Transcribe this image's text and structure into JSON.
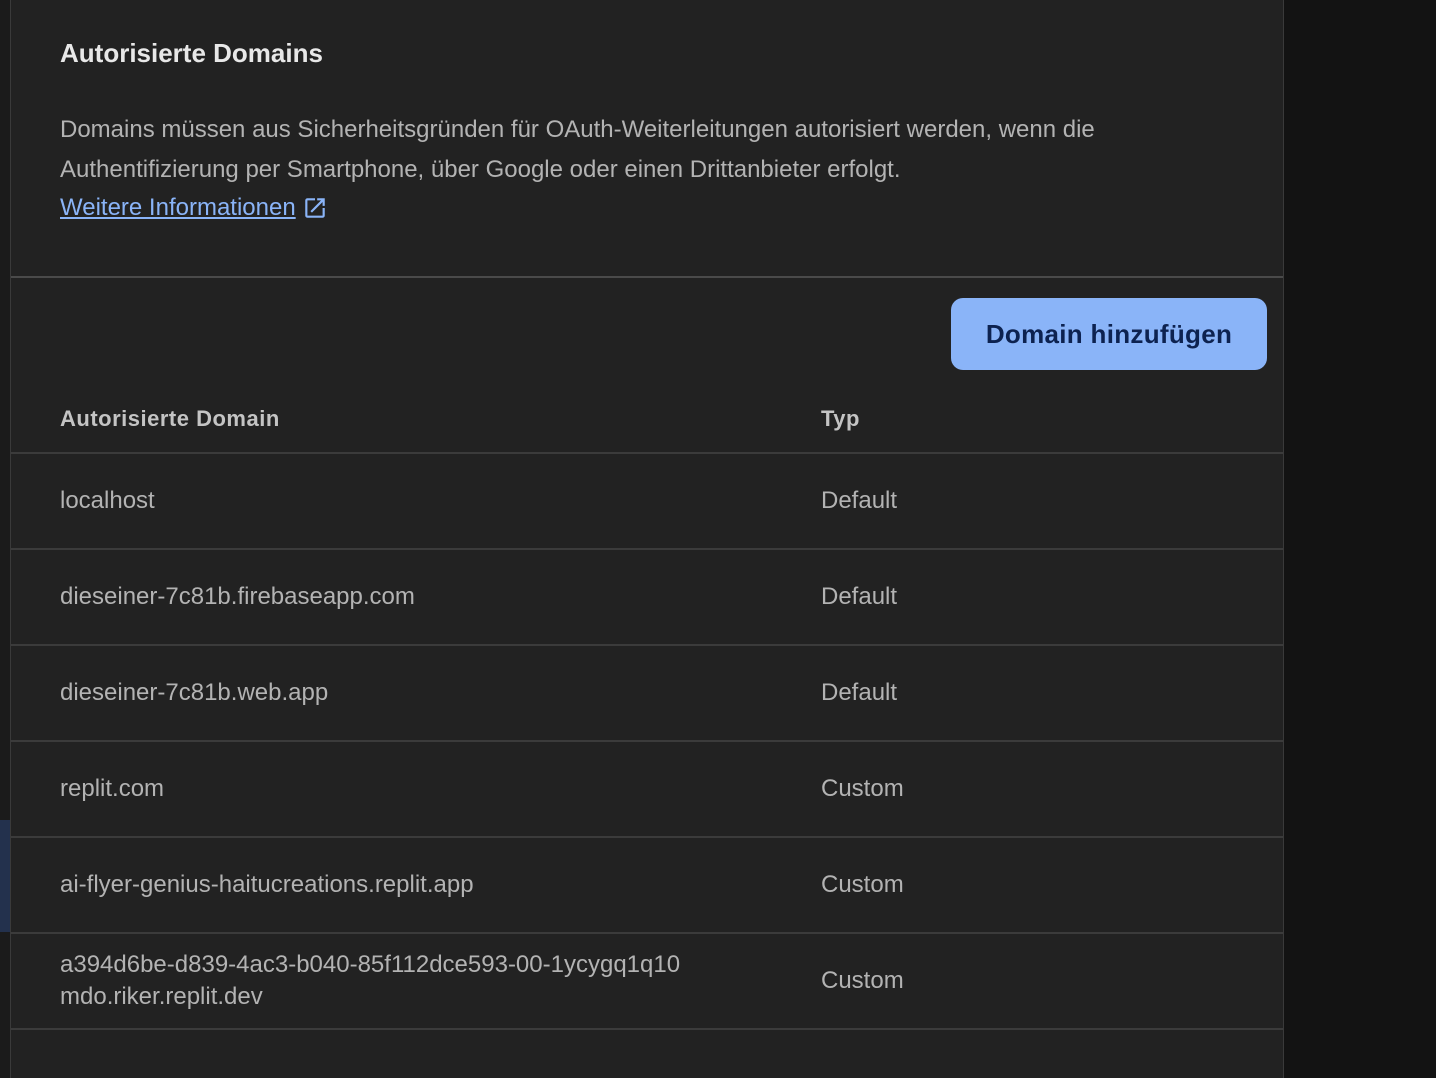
{
  "section": {
    "title": "Autorisierte Domains",
    "description": "Domains müssen aus Sicherheitsgründen für OAuth-Weiterleitungen autorisiert werden, wenn die Authentifizierung per Smartphone, über Google oder einen Drittanbieter erfolgt.",
    "learn_more_label": "Weitere Informationen",
    "learn_more_icon": "open-in-new-icon"
  },
  "toolbar": {
    "add_domain_label": "Domain hinzufügen"
  },
  "table": {
    "columns": {
      "domain": "Autorisierte Domain",
      "type": "Typ"
    },
    "rows": [
      {
        "domain": "localhost",
        "type": "Default"
      },
      {
        "domain": "dieseiner-7c81b.firebaseapp.com",
        "type": "Default"
      },
      {
        "domain": "dieseiner-7c81b.web.app",
        "type": "Default"
      },
      {
        "domain": "replit.com",
        "type": "Custom"
      },
      {
        "domain": "ai-flyer-genius-haitucreations.replit.app",
        "type": "Custom"
      },
      {
        "domain": "a394d6be-d839-4ac3-b040-85f112dce593-00-1ycygq1q10mdo.riker.replit.dev",
        "type": "Custom"
      }
    ]
  },
  "colors": {
    "accent": "#8ab4f8",
    "card_bg": "#222222",
    "text": "#b3b3b3"
  }
}
